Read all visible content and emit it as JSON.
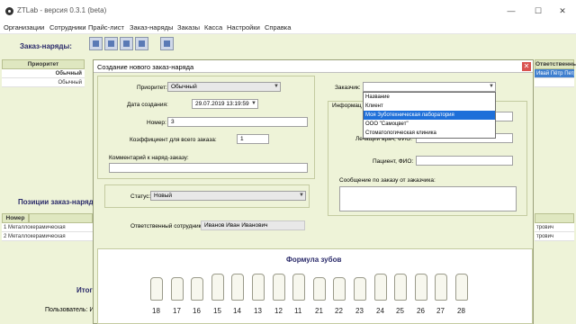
{
  "app": {
    "title": "ZTLab - версия 0.3.1 (beta)"
  },
  "window_controls": {
    "minimize": "—",
    "maximize": "☐",
    "close": "✕"
  },
  "menu": [
    "Организации",
    "Сотрудники",
    "Прайс-лист",
    "Заказ-наряды",
    "Заказы",
    "Касса",
    "Настройки",
    "Справка"
  ],
  "orders": {
    "title": "Заказ-наряды:",
    "columns": [
      "Приоритет",
      "Ответственный"
    ],
    "rows": [
      {
        "priority": "Обычный",
        "responsible": "Ивай Пётр Петр..."
      },
      {
        "priority": "Обычный",
        "responsible": ""
      }
    ]
  },
  "positions": {
    "title": "Позиции заказ-наряда",
    "columns": [
      "Номер"
    ],
    "rows": [
      {
        "number": "1",
        "name": "Металлокерамическая"
      },
      {
        "number": "2",
        "name": "Металлокерамическая"
      }
    ],
    "right_values": [
      "трович",
      "трович"
    ],
    "total_label": "Итог",
    "user_label": "Пользователь: И"
  },
  "dialog": {
    "title": "Создание нового заказ-наряда",
    "close": "✕",
    "priority_label": "Приоритет:",
    "priority_value": "Обычный",
    "created_label": "Дата создания:",
    "created_value": "29.07.2019 13:19:59",
    "number_label": "Номер:",
    "number_value": "3",
    "coef_label": "Коэффициент для всего заказа:",
    "coef_value": "1",
    "comment_label": "Комментарий к наряд-заказу:",
    "status_label": "Статус:",
    "status_value": "Новый",
    "responsible_label": "Ответственный сотрудник:",
    "responsible_value": "Иванов Иван Иванович",
    "customer_label": "Заказчик:",
    "info_label": "Информац",
    "doctor_label": "Лечащий врач, ФИО:",
    "patient_label": "Пациент, ФИО:",
    "message_label": "Сообщение по заказу от заказчика:",
    "customer_options": [
      "Название",
      "Клиент",
      "Моя Зуботехническая лаборатория",
      "ООО \"Самоцвет\"",
      "Стоматологическая клиника"
    ],
    "selected_option": 2
  },
  "teeth": {
    "title": "Формула зубов",
    "numbers": [
      "18",
      "17",
      "16",
      "15",
      "14",
      "13",
      "12",
      "11",
      "21",
      "22",
      "23",
      "24",
      "25",
      "26",
      "27",
      "28"
    ]
  }
}
